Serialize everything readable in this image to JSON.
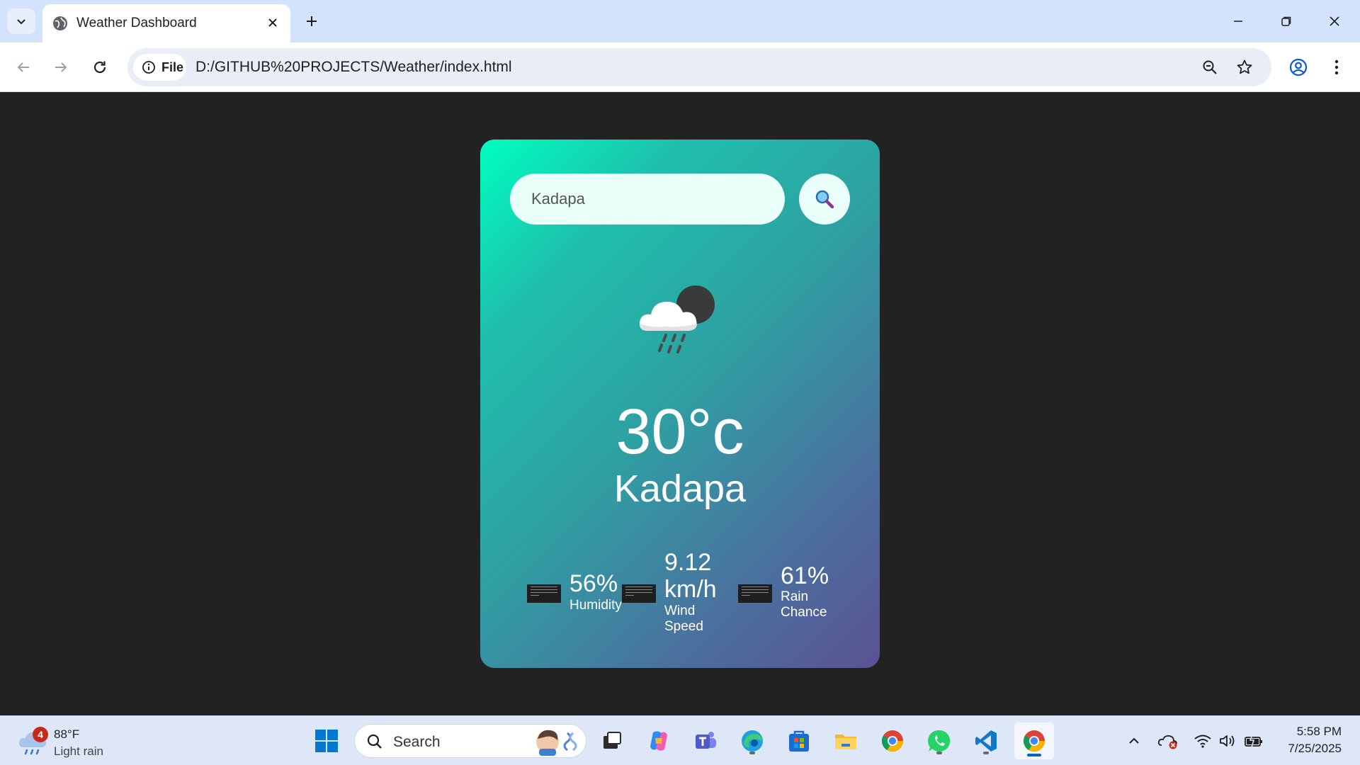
{
  "browser": {
    "tab_title": "Weather Dashboard",
    "site_chip_label": "File",
    "url": "D:/GITHUB%20PROJECTS/Weather/index.html"
  },
  "weather": {
    "search_value": "Kadapa",
    "icon": "cloud-rain-moon-icon",
    "temperature": "30°c",
    "city": "Kadapa",
    "humidity_value": "56%",
    "humidity_label": "Humidity",
    "wind_value_line1": "9.12",
    "wind_value_line2": "km/h",
    "wind_label_line1": "Wind",
    "wind_label_line2": "Speed",
    "rain_value": "61%",
    "rain_label_line1": "Rain",
    "rain_label_line2": "Chance",
    "colors": {
      "gradient_start": "#00ffc0",
      "gradient_end": "#5b5293",
      "search_bg": "#ebfffa"
    }
  },
  "taskbar": {
    "weather_badge": "4",
    "weather_temp": "88°F",
    "weather_condition": "Light rain",
    "search_label": "Search",
    "time": "5:58 PM",
    "date": "7/25/2025"
  }
}
